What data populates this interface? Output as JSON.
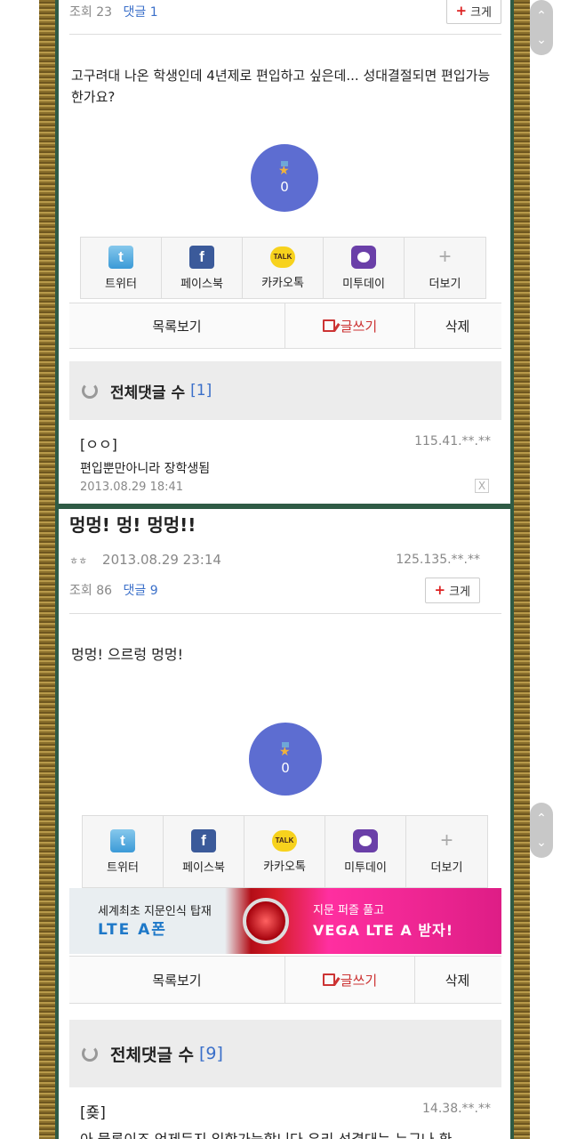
{
  "post1": {
    "views_label": "조회 23",
    "comments_label": "댓글 1",
    "enlarge_label": "크게",
    "body": "고구려대 나온 학생인데 4년제로 편입하고 싶은데... 성대결절되면 편입가능한가요?",
    "like_count": "0",
    "share": [
      "트위터",
      "페이스북",
      "카카오톡",
      "미투데이",
      "더보기"
    ],
    "actions": {
      "list": "목록보기",
      "write": "글쓰기",
      "delete": "삭제"
    },
    "comments_header": {
      "label": "전체댓글 수",
      "count": "[1]"
    },
    "comment": {
      "author": "[ㅇㅇ]",
      "ip": "115.41.**.**",
      "text": "편입뿐만아니라 장학생됨",
      "date": "2013.08.29 18:41",
      "delete": "X"
    }
  },
  "post2": {
    "title": "멍멍! 멍! 멍멍!!",
    "author": "ㅎㅎ",
    "datetime": "2013.08.29 23:14",
    "ip": "125.135.**.**",
    "views_label": "조회 86",
    "comments_label": "댓글 9",
    "enlarge_label": "크게",
    "body": "멍멍! 으르렁 멍멍!",
    "like_count": "0",
    "share": [
      "트위터",
      "페이스북",
      "카카오톡",
      "미투데이",
      "더보기"
    ],
    "ad": {
      "line1": "세계최초 지문인식 탑재",
      "line2": "LTE A폰",
      "line3": "지문 퍼즐 풀고",
      "line4": "VEGA LTE A 받자!"
    },
    "actions": {
      "list": "목록보기",
      "write": "글쓰기",
      "delete": "삭제"
    },
    "comments_header": {
      "label": "전체댓글 수",
      "count": "[9]"
    },
    "comment": {
      "author": "[죶]",
      "ip": "14.38.**.**",
      "text": "아 물론이죠 언제든지 입학가능합니다 우리 성결대는 누구나 환"
    }
  },
  "icons": {
    "twitter": "t",
    "facebook": "f",
    "kakao": "TALK",
    "more": "+"
  },
  "colors": {
    "accent_blue": "#3a6fc9",
    "like_circle": "#5d6dd1",
    "write_red": "#c33",
    "frame_green": "#2f5b45"
  }
}
